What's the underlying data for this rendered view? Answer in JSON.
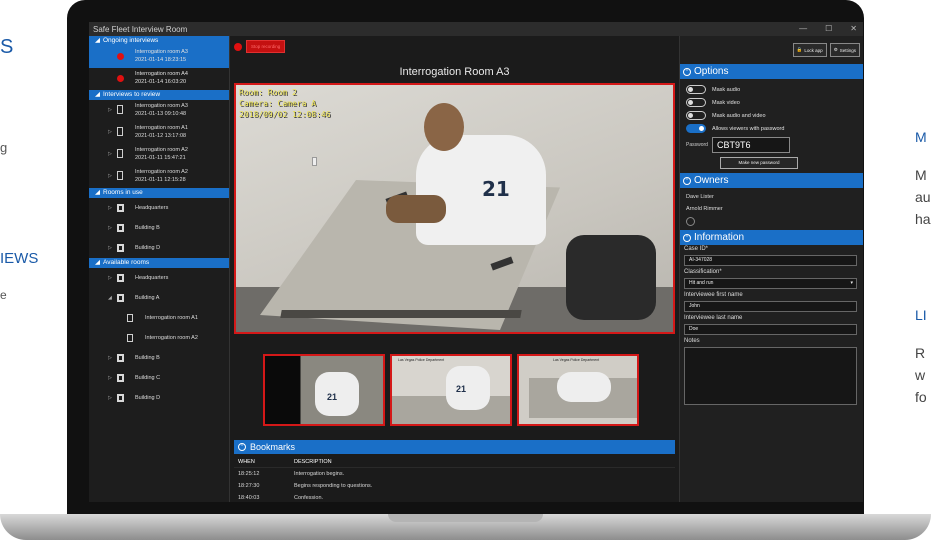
{
  "marketing": {
    "left_heading": "S",
    "left_line": "g",
    "left_views_heading": "IEWS",
    "left_views_text": "e",
    "right_m_heading": "M",
    "right_m_lines": [
      "M",
      "au",
      "ha"
    ],
    "right_l_heading": "LI",
    "right_l_lines": [
      "R",
      "w",
      "fo"
    ]
  },
  "window": {
    "title": "Safe Fleet Interview Room",
    "controls": [
      "—",
      "☐",
      "✕"
    ]
  },
  "sidebar": {
    "ongoing": {
      "header": "Ongoing interviews",
      "items": [
        {
          "name": "Interrogation room A3",
          "time": "2021-01-14 18:23:15"
        },
        {
          "name": "Interrogation room A4",
          "time": "2021-01-14 16:03:20"
        }
      ]
    },
    "review": {
      "header": "Interviews to review",
      "items": [
        {
          "name": "Interrogation room A3",
          "time": "2021-01-13 09:10:48"
        },
        {
          "name": "Interrogation room A1",
          "time": "2021-01-12 13:17:08"
        },
        {
          "name": "Interrogation room A2",
          "time": "2021-01-11 15:47:21"
        },
        {
          "name": "Interrogation room A2",
          "time": "2021-01-11 12:15:28"
        }
      ]
    },
    "in_use": {
      "header": "Rooms in use",
      "items": [
        "Headquarters",
        "Building B",
        "Building D"
      ]
    },
    "available": {
      "header": "Available rooms",
      "items": [
        "Headquarters",
        "Building A",
        "Interrogation room A1",
        "Interrogation room A2",
        "Building B",
        "Building C",
        "Building D"
      ]
    }
  },
  "main": {
    "stop_label": "Stop recording",
    "room_title": "Interrogation Room A3",
    "overlay": [
      "Room: Room 2",
      "Camera: Camera A",
      "2018/09/02 12:08:46"
    ],
    "thumb_caption": "Las Vegas Police Department"
  },
  "bookmarks": {
    "header": "Bookmarks",
    "columns": [
      "WHEN",
      "DESCRIPTION"
    ],
    "rows": [
      {
        "when": "18:25:12",
        "desc": "Interrogation begins."
      },
      {
        "when": "18:27:30",
        "desc": "Begins responding to questions."
      },
      {
        "when": "18:40:03",
        "desc": "Confession."
      }
    ]
  },
  "toolbar": {
    "lock_label": "Lock app",
    "settings_label": "Settings"
  },
  "options": {
    "header": "Options",
    "toggles": [
      {
        "label": "Mask audio",
        "on": false
      },
      {
        "label": "Mask video",
        "on": false
      },
      {
        "label": "Mask audio and video",
        "on": false
      },
      {
        "label": "Allows viewers with password",
        "on": true
      }
    ],
    "password_label": "Password",
    "password_value": "CBT9T6",
    "make_password_label": "Make new password"
  },
  "owners": {
    "header": "Owners",
    "names": [
      "Dave Lister",
      "Arnold Rimmer"
    ]
  },
  "information": {
    "header": "Information",
    "case_id_label": "Case ID*",
    "case_id_value": "AI-347028",
    "classification_label": "Classification*",
    "classification_value": "Hit and run",
    "first_name_label": "Interviewee first name",
    "first_name_value": "John",
    "last_name_label": "Interviewee last name",
    "last_name_value": "Doe",
    "notes_label": "Notes"
  },
  "colors": {
    "accent": "#1a6fc7",
    "record": "#e01010",
    "video_border": "#d41818"
  }
}
